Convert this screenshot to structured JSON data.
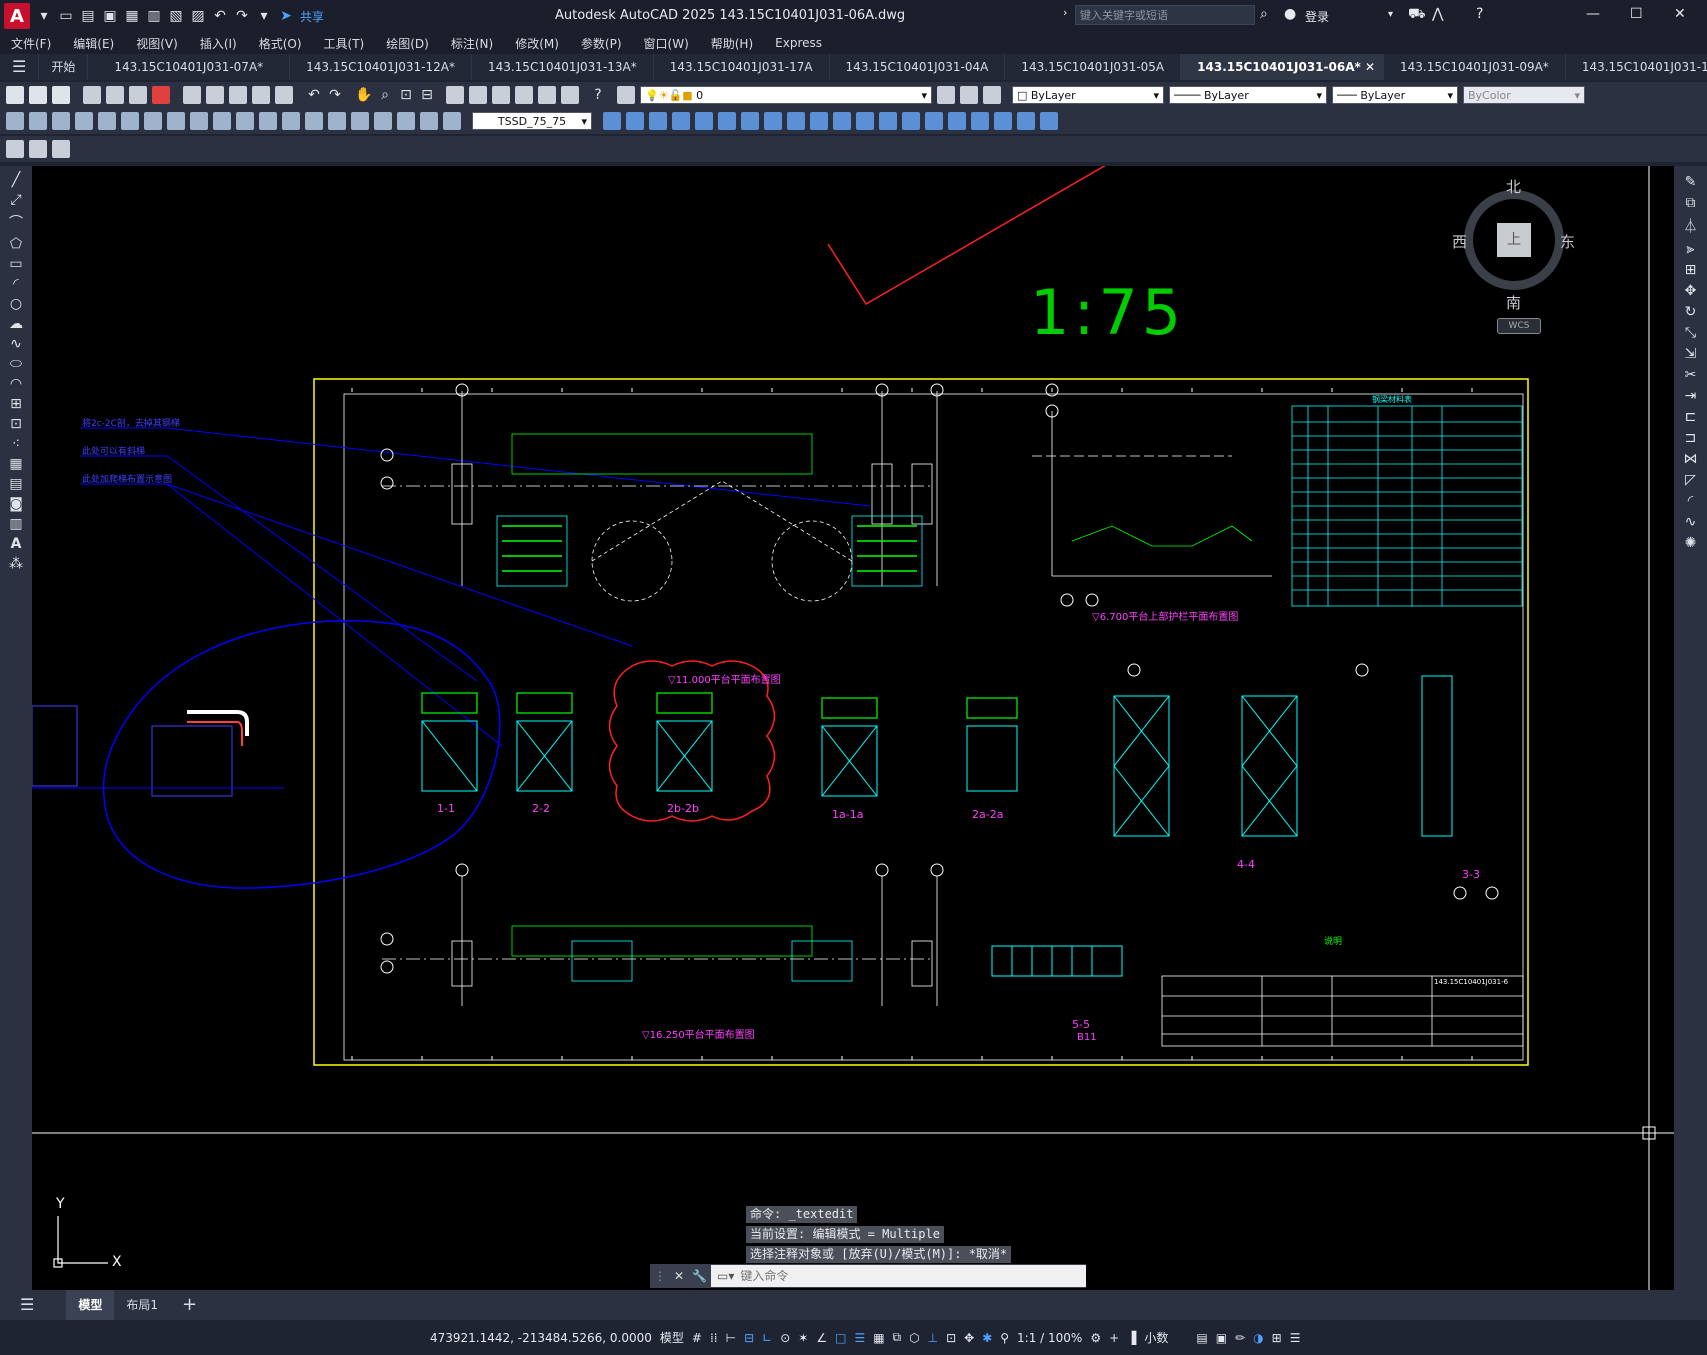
{
  "title": "Autodesk AutoCAD 2025    143.15C10401J031-06A.dwg",
  "app_logo": "A",
  "share_label": "共享",
  "search": {
    "placeholder": "键入关键字或短语"
  },
  "login_label": "登录",
  "menu": [
    "文件(F)",
    "编辑(E)",
    "视图(V)",
    "插入(I)",
    "格式(O)",
    "工具(T)",
    "绘图(D)",
    "标注(N)",
    "修改(M)",
    "参数(P)",
    "窗口(W)",
    "帮助(H)",
    "Express"
  ],
  "doc_tabs": [
    {
      "label": "开始",
      "active": false
    },
    {
      "label": "143.15C10401J031-07A*",
      "active": false
    },
    {
      "label": "143.15C10401J031-12A*",
      "active": false
    },
    {
      "label": "143.15C10401J031-13A*",
      "active": false
    },
    {
      "label": "143.15C10401J031-17A",
      "active": false
    },
    {
      "label": "143.15C10401J031-04A",
      "active": false
    },
    {
      "label": "143.15C10401J031-05A",
      "active": false
    },
    {
      "label": "143.15C10401J031-06A*",
      "active": true
    },
    {
      "label": "143.15C10401J031-09A*",
      "active": false
    },
    {
      "label": "143.15C10401J031-15A*",
      "active": false
    }
  ],
  "layer": {
    "current": "0"
  },
  "properties": {
    "color": "ByLayer",
    "linetype": "ByLayer",
    "lineweight": "ByLayer",
    "plotstyle": "ByColor"
  },
  "dimstyle": "TSSD_75_75",
  "viewcube": {
    "north": "北",
    "south": "南",
    "east": "东",
    "west": "西",
    "face": "上",
    "ucs": "WCS"
  },
  "drawing": {
    "scale_text": "1:75",
    "view_labels": [
      "1-1",
      "2-2",
      "2b-2b",
      "1a-1a",
      "2a-2a",
      "4-4",
      "3-3",
      "5-5"
    ],
    "plan_titles": [
      "▽11.000平台平面布置图",
      "▽16.250平台平面布置图",
      "▽6.700平台上部护栏平面布置图"
    ],
    "annotations": [
      "将2c-2C剖，去掉其钢梯",
      "此处可以有斜梯",
      "此处加爬梯布置示意图"
    ],
    "table_title": "钢梁材料表",
    "notes_title": "说明",
    "detail_label": "B11",
    "titleblock_no": "143.15C10401J031-6"
  },
  "command": {
    "history": [
      "命令: _textedit",
      "当前设置: 编辑模式 = Multiple",
      "选择注释对象或 [放弃(U)/模式(M)]: *取消*"
    ],
    "placeholder": "键入命令"
  },
  "layout_tabs": [
    "模型",
    "布局1"
  ],
  "status": {
    "coords": "473921.1442, -213484.5266, 0.0000",
    "mode": "模型",
    "scale": "1:1 / 100%",
    "units": "小数"
  },
  "colors": {
    "background": "#000000",
    "frame": "#ffff00",
    "green": "#00ff00",
    "cyan": "#00ffff",
    "red": "#ff0000",
    "blue": "#0000ff",
    "magenta": "#ff00ff"
  }
}
